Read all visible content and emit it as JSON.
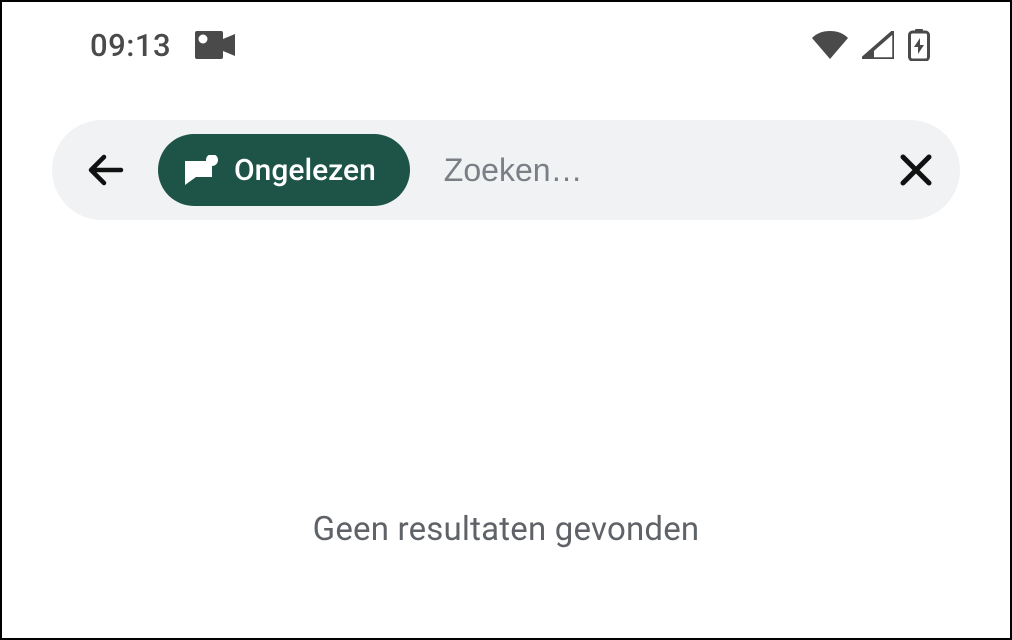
{
  "status_bar": {
    "time": "09:13"
  },
  "search": {
    "filter_label": "Ongelezen",
    "placeholder": "Zoeken…"
  },
  "main": {
    "empty_message": "Geen resultaten gevonden"
  }
}
